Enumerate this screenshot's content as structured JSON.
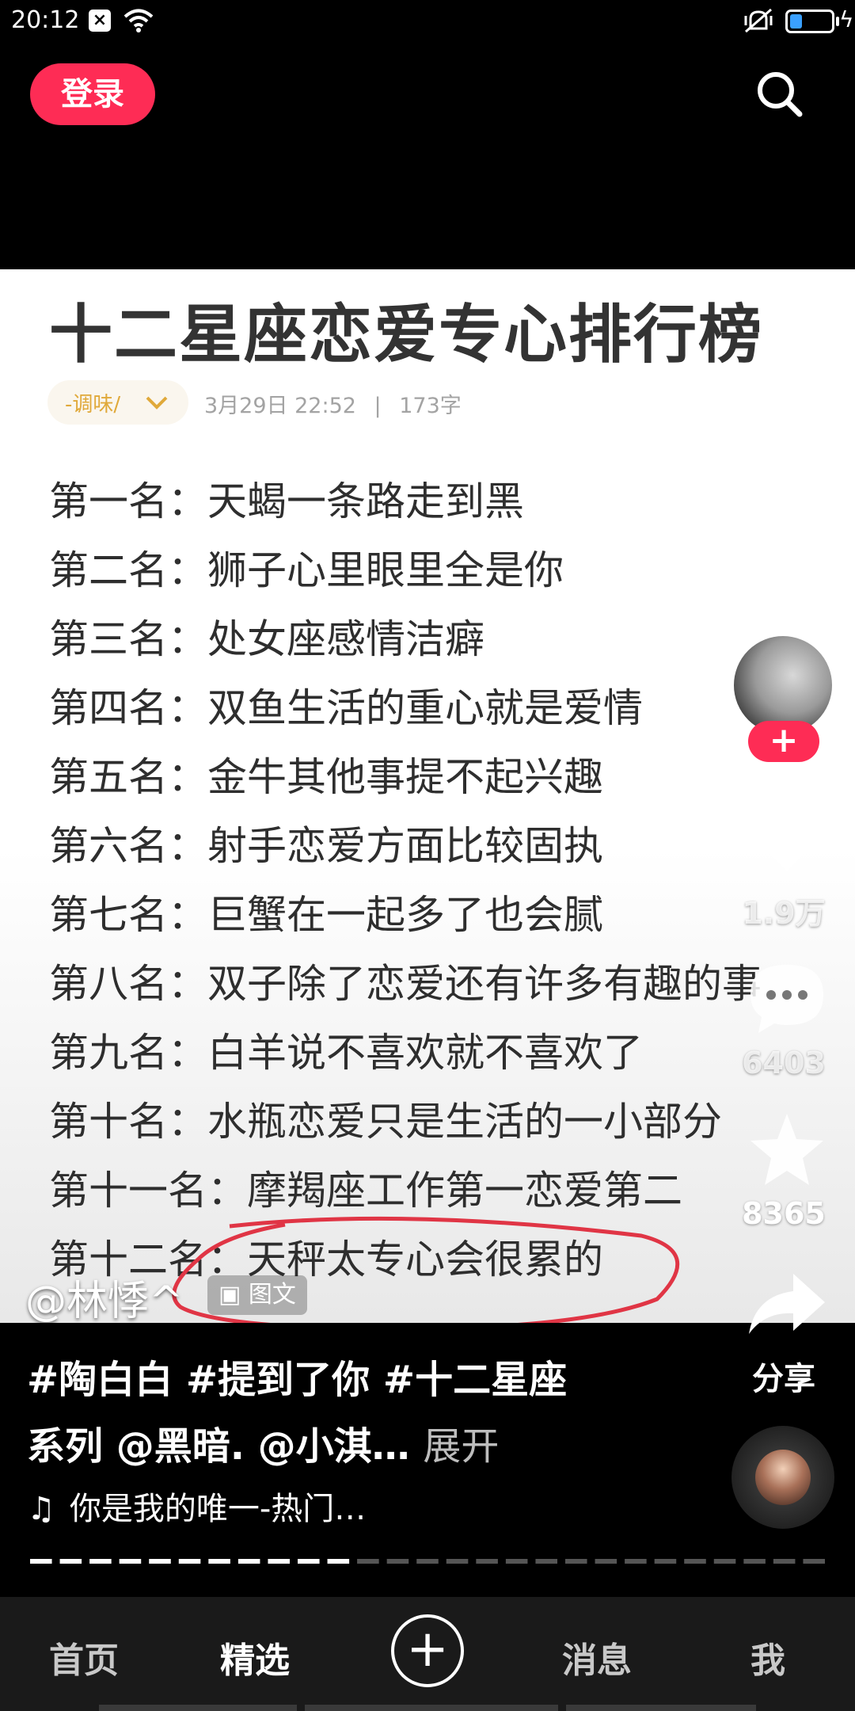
{
  "status_bar": {
    "time": "20:12",
    "notification_icon": "close-box-icon",
    "wifi_icon": "wifi-icon",
    "mute_icon": "mute-icon",
    "battery_level": 0.3,
    "charging_glyph": "ϟ"
  },
  "header": {
    "login_label": "登录",
    "search_icon": "search-icon",
    "accent_color": "#fe2c55"
  },
  "article": {
    "title": "十二星座恋爱专心排行榜",
    "tag": "-调味/",
    "date": "3月29日 22:52",
    "separator": "|",
    "word_count": "173字",
    "rankings": [
      "第一名：天蝎一条路走到黑",
      "第二名：狮子心里眼里全是你",
      "第三名：处女座感情洁癖",
      "第四名：双鱼生活的重心就是爱情",
      "第五名：金牛其他事提不起兴趣",
      "第六名：射手恋爱方面比较固执",
      "第七名：巨蟹在一起多了也会腻",
      "第八名：双子除了恋爱还有许多有趣的事",
      "第九名：白羊说不喜欢就不喜欢了",
      "第十名：水瓶恋爱只是生活的一小部分",
      "第十一名：摩羯座工作第一恋爱第二",
      "第十二名：天秤太专心会很累的"
    ]
  },
  "overlay": {
    "author": "@林悸^",
    "content_type": "图文"
  },
  "rail": {
    "follow_label": "+",
    "like_count": "1.9万",
    "comment_count": "6403",
    "favorite_count": "8365",
    "share_label": "分享"
  },
  "caption": {
    "text": "#陶白白 #提到了你 #十二星座系列 @黑暗. @小淇…",
    "expand": "展开",
    "music": "你是我的唯一-热门…"
  },
  "bottom_nav": {
    "home": "首页",
    "featured": "精选",
    "plus": "+",
    "messages": "消息",
    "me": "我"
  }
}
